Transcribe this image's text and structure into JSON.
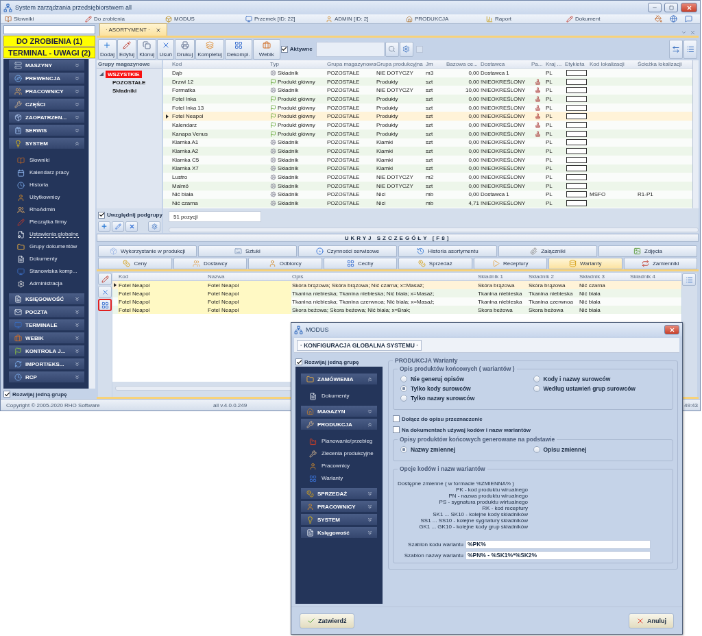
{
  "window": {
    "title": "System zarządzania przedsiębiorstwem all"
  },
  "menu_bar": [
    "Słowniki",
    "Do zrobienia",
    "MODUS",
    "Przemek [ID: 22]",
    "ADMIN [ID: 2]",
    "PRODUKCJA",
    "Raport",
    "Dokument"
  ],
  "banners": [
    "DO ZROBIENIA (1)",
    "TERMINAL - UWAGI (2)"
  ],
  "nav": [
    {
      "label": "MASZYNY",
      "expanded": false
    },
    {
      "label": "PREWENCJA",
      "expanded": false
    },
    {
      "label": "PRACOWNICY",
      "expanded": false
    },
    {
      "label": "CZĘŚCI",
      "expanded": false
    },
    {
      "label": "ZAOPATRZEN...",
      "expanded": false
    },
    {
      "label": "SERWIS",
      "expanded": false
    },
    {
      "label": "SYSTEM",
      "expanded": true,
      "items": [
        {
          "label": "Słowniki",
          "selected": false
        },
        {
          "label": "Kalendarz pracy",
          "selected": false
        },
        {
          "label": "Historia",
          "selected": false
        },
        {
          "label": "Użytkownicy",
          "selected": false
        },
        {
          "label": "RhoAdmin",
          "selected": false
        },
        {
          "label": "Pieczątka firmy",
          "selected": false
        },
        {
          "label": "Ustawienia globalne",
          "selected": true
        },
        {
          "label": "Grupy dokumentów",
          "selected": false
        },
        {
          "label": "Dokumenty",
          "selected": false
        },
        {
          "label": "Stanowiska komp...",
          "selected": false
        },
        {
          "label": "Administracja",
          "selected": false
        }
      ]
    },
    {
      "label": "KSIĘGOWOŚĆ",
      "expanded": false
    },
    {
      "label": "POCZTA",
      "expanded": false
    },
    {
      "label": "TERMINALE",
      "expanded": false
    },
    {
      "label": "WEBIK",
      "expanded": false
    },
    {
      "label": "KONTROLA J...",
      "expanded": false
    },
    {
      "label": "IMPORT/EKS...",
      "expanded": false
    },
    {
      "label": "RCP",
      "expanded": false
    }
  ],
  "expand_one_group": {
    "label": "Rozwijaj jedną grupę",
    "checked": true
  },
  "doc_tabs": [
    {
      "label": "· ASORTYMENT ·",
      "selected": true
    }
  ],
  "toolbar": {
    "buttons": [
      "Dodaj",
      "Edytuj",
      "Klonuj",
      "Usuń",
      "Drukuj",
      "Kompletuj",
      "Dekompl.",
      "Webik"
    ],
    "active_filter": {
      "label": "Aktywne",
      "checked": true
    }
  },
  "groups": {
    "title": "Grupy magazynowe",
    "tree": [
      {
        "label": "WSZYSTKIE",
        "selected": true,
        "expanded": true,
        "children": [
          {
            "label": "POZOSTAŁE",
            "selected": false
          },
          {
            "label": "Składniki",
            "selected": false
          }
        ]
      }
    ],
    "include_subgroups": {
      "label": "Uwzględnij podgrupy",
      "checked": true
    }
  },
  "table": {
    "columns": [
      "Kod",
      "Typ",
      "Grupa magazynowa",
      "Grupa produkcyjna",
      "Jm",
      "Bazowa ce...",
      "Dostawca",
      "Pa...",
      "Kraj ...",
      "Etykieta",
      "Kod lokalizacji",
      "Ścieżka lokalizacji"
    ],
    "rows": [
      {
        "kod": "Dąb",
        "typ": "Składnik",
        "kind": "component",
        "grupa_mag": "POZOSTAŁE",
        "grupa_prod": "NIE DOTYCZY",
        "jm": "m3",
        "cena": "0,00",
        "dostawca": "Dostawca 1",
        "pa_icon": false,
        "kraj": "PL",
        "selected": false
      },
      {
        "kod": "Drzwi 12",
        "typ": "Produkt główny",
        "kind": "product",
        "grupa_mag": "POZOSTAŁE",
        "grupa_prod": "Produkty",
        "jm": "szt",
        "cena": "0,00",
        "dostawca": "!NIEOKREŚLONY",
        "pa_icon": true,
        "kraj": "PL",
        "selected": false
      },
      {
        "kod": "Formatka",
        "typ": "Składnik",
        "kind": "component",
        "grupa_mag": "POZOSTAŁE",
        "grupa_prod": "NIE DOTYCZY",
        "jm": "szt",
        "cena": "10,00",
        "dostawca": "!NIEOKREŚLONY",
        "pa_icon": true,
        "kraj": "PL",
        "selected": false
      },
      {
        "kod": "Fotel Inka",
        "typ": "Produkt główny",
        "kind": "product",
        "grupa_mag": "POZOSTAŁE",
        "grupa_prod": "Produkty",
        "jm": "szt",
        "cena": "0,00",
        "dostawca": "!NIEOKREŚLONY",
        "pa_icon": true,
        "kraj": "PL",
        "selected": false
      },
      {
        "kod": "Fotel Inka 13",
        "typ": "Produkt główny",
        "kind": "product",
        "grupa_mag": "POZOSTAŁE",
        "grupa_prod": "Produkty",
        "jm": "szt",
        "cena": "0,00",
        "dostawca": "!NIEOKREŚLONY",
        "pa_icon": true,
        "kraj": "PL",
        "selected": false
      },
      {
        "kod": "Fotel Neapol",
        "typ": "Produkt główny",
        "kind": "product",
        "grupa_mag": "POZOSTAŁE",
        "grupa_prod": "Produkty",
        "jm": "szt",
        "cena": "0,00",
        "dostawca": "!NIEOKREŚLONY",
        "pa_icon": true,
        "kraj": "PL",
        "selected": true
      },
      {
        "kod": "Kalendarz",
        "typ": "Produkt główny",
        "kind": "product",
        "grupa_mag": "POZOSTAŁE",
        "grupa_prod": "Produkty",
        "jm": "szt",
        "cena": "0,00",
        "dostawca": "!NIEOKREŚLONY",
        "pa_icon": true,
        "kraj": "PL",
        "selected": false
      },
      {
        "kod": "Kanapa Venus",
        "typ": "Produkt główny",
        "kind": "product",
        "grupa_mag": "POZOSTAŁE",
        "grupa_prod": "Produkty",
        "jm": "szt",
        "cena": "0,00",
        "dostawca": "!NIEOKREŚLONY",
        "pa_icon": true,
        "kraj": "PL",
        "selected": false
      },
      {
        "kod": "Klamka A1",
        "typ": "Składnik",
        "kind": "component",
        "grupa_mag": "POZOSTAŁE",
        "grupa_prod": "Klamki",
        "jm": "szt",
        "cena": "0,00",
        "dostawca": "!NIEOKREŚLONY",
        "pa_icon": false,
        "kraj": "PL",
        "selected": false
      },
      {
        "kod": "Klamka A2",
        "typ": "Składnik",
        "kind": "component",
        "grupa_mag": "POZOSTAŁE",
        "grupa_prod": "Klamki",
        "jm": "szt",
        "cena": "0,00",
        "dostawca": "!NIEOKREŚLONY",
        "pa_icon": false,
        "kraj": "PL",
        "selected": false
      },
      {
        "kod": "Klamka C5",
        "typ": "Składnik",
        "kind": "component",
        "grupa_mag": "POZOSTAŁE",
        "grupa_prod": "Klamki",
        "jm": "szt",
        "cena": "0,00",
        "dostawca": "!NIEOKREŚLONY",
        "pa_icon": false,
        "kraj": "PL",
        "selected": false
      },
      {
        "kod": "Klamka X7",
        "typ": "Składnik",
        "kind": "component",
        "grupa_mag": "POZOSTAŁE",
        "grupa_prod": "Klamki",
        "jm": "szt",
        "cena": "0,00",
        "dostawca": "!NIEOKREŚLONY",
        "pa_icon": false,
        "kraj": "PL",
        "selected": false
      },
      {
        "kod": "Lustro",
        "typ": "Składnik",
        "kind": "component",
        "grupa_mag": "POZOSTAŁE",
        "grupa_prod": "NIE DOTYCZY",
        "jm": "m2",
        "cena": "0,00",
        "dostawca": "!NIEOKREŚLONY",
        "pa_icon": false,
        "kraj": "PL",
        "selected": false
      },
      {
        "kod": "Malmö",
        "typ": "Składnik",
        "kind": "component",
        "grupa_mag": "POZOSTAŁE",
        "grupa_prod": "NIE DOTYCZY",
        "jm": "szt",
        "cena": "0,00",
        "dostawca": "!NIEOKREŚLONY",
        "pa_icon": false,
        "kraj": "PL",
        "selected": false
      },
      {
        "kod": "Nić biała",
        "typ": "Składnik",
        "kind": "component",
        "grupa_mag": "POZOSTAŁE",
        "grupa_prod": "Nici",
        "jm": "mb",
        "cena": "0,00",
        "dostawca": "Dostawca 1",
        "pa_icon": false,
        "kraj": "PL",
        "kod_lok": "MSFO",
        "sciezka": "R1-P1",
        "selected": false
      },
      {
        "kod": "Nić czarna",
        "typ": "Składnik",
        "kind": "component",
        "grupa_mag": "POZOSTAŁE",
        "grupa_prod": "Nici",
        "jm": "mb",
        "cena": "4,71",
        "dostawca": "!NIEOKREŚLONY",
        "pa_icon": false,
        "kraj": "PL",
        "selected": false
      }
    ],
    "count": "51 pozycji"
  },
  "details_toggle": "UKRYJ SZCZEGÓŁY [F8]",
  "detail_tabs": [
    [
      {
        "label": "Wykorzystanie w produkcji",
        "selected": false
      },
      {
        "label": "Sztuki",
        "selected": false
      },
      {
        "label": "Czynności serwisowe",
        "selected": false
      },
      {
        "label": "Historia asortymentu",
        "selected": false
      },
      {
        "label": "Załączniki",
        "selected": false
      },
      {
        "label": "Zdjęcia",
        "selected": false
      }
    ],
    [
      {
        "label": "Ceny",
        "selected": false
      },
      {
        "label": "Dostawcy",
        "selected": false
      },
      {
        "label": "Odbiorcy",
        "selected": false
      },
      {
        "label": "Cechy",
        "selected": false
      },
      {
        "label": "Sprzedaż",
        "selected": false
      },
      {
        "label": "Receptury",
        "selected": false
      },
      {
        "label": "Warianty",
        "selected": true
      },
      {
        "label": "Zamienniki",
        "selected": false
      }
    ]
  ],
  "variants": {
    "tools": [
      {
        "highlighted": false
      },
      {
        "highlighted": false
      },
      {
        "highlighted": true
      }
    ],
    "columns": [
      "Kod",
      "Nazwa",
      "Opis",
      "Składnik 1",
      "Składnik 2",
      "Składnik 3",
      "Składnik 4"
    ],
    "rows": [
      {
        "kod": "Fotel Neapol",
        "nazwa": "Fotel Neapol",
        "opis": "Skóra brązowa; Skóra brązowa; Nić czarna; x=Masaż;",
        "s1": "Skóra brązowa",
        "s2": "Skóra brązowa",
        "s3": "Nić czarna",
        "selected": true
      },
      {
        "kod": "Fotel Neapol",
        "nazwa": "Fotel Neapol",
        "opis": "Tkanina niebieska; Tkanina niebieska; Nić biała; x=Masaż;",
        "s1": "Tkanina niebieska",
        "s2": "Tkanina niebieska",
        "s3": "Nić biała",
        "selected": false
      },
      {
        "kod": "Fotel Neapol",
        "nazwa": "Fotel Neapol",
        "opis": "Tkanina niebieska; Tkanina czerwnoa; Nić biała; x=Masaż;",
        "s1": "Tkanina niebieska",
        "s2": "Tkanina czerwnoa",
        "s3": "Nić biała",
        "selected": false
      },
      {
        "kod": "Fotel Neapol",
        "nazwa": "Fotel Neapol",
        "opis": "Skora beżowa; Skora beżowa; Nić biała; x=Brak;",
        "s1": "Skora beżowa",
        "s2": "Skora beżowa",
        "s3": "Nić biała",
        "selected": false
      }
    ]
  },
  "status_bar": {
    "copyright": "Copyright © 2005-2020 RHO Software",
    "version": "all v.4.0.0.249",
    "time": "49:43"
  },
  "dialog": {
    "title": "MODUS",
    "tab": "· KONFIGURACJA GLOBALNA SYSTEMU ·",
    "expand_one_group": {
      "label": "Rozwijaj jedną grupę",
      "checked": true
    },
    "nav": [
      {
        "label": "ZAMÓWIENIA",
        "expanded": true,
        "items": [
          {
            "label": "Dokumenty"
          }
        ]
      },
      {
        "label": "MAGAZYN",
        "expanded": false
      },
      {
        "label": "PRODUKCJA",
        "expanded": true,
        "items": [
          {
            "label": "Planowanie/przebieg"
          },
          {
            "label": "Zlecenia produkcyjne"
          },
          {
            "label": "Pracownicy"
          },
          {
            "label": "Warianty"
          }
        ]
      },
      {
        "label": "SPRZEDAŻ",
        "expanded": false
      },
      {
        "label": "PRACOWNICY",
        "expanded": false
      },
      {
        "label": "SYSTEM",
        "expanded": false
      },
      {
        "label": "Księgowość",
        "expanded": false
      }
    ],
    "section": {
      "title": "PRODUKCJA Warianty",
      "description": {
        "title": "Opis produktów końcowych ( wariantów )",
        "options": [
          {
            "label": "Nie generuj opisów",
            "selected": false
          },
          {
            "label": "Kody i nazwy surowców",
            "selected": false
          },
          {
            "label": "Tylko kody surowców",
            "selected": true
          },
          {
            "label": "Według ustawień grup surowców",
            "selected": false
          },
          {
            "label": "Tylko nazwy surowców",
            "selected": false
          }
        ]
      },
      "checkboxes": [
        {
          "label": "Dołącz do opisu przeznaczenie",
          "checked": false
        },
        {
          "label": "Na dokumentach używaj kodów i nazw wariantów",
          "checked": false
        }
      ],
      "source": {
        "title": "Opisy produktów końcowych generowane na podstawie",
        "options": [
          {
            "label": "Nazwy zmiennej",
            "selected": true
          },
          {
            "label": "Opisu zmiennej",
            "selected": false
          }
        ]
      },
      "codes": {
        "title": "Opcje kodów i nazw wariantów",
        "help_title": "Dostępne zmienne ( w formacie %ZMIENNA% )",
        "help": [
          "PK - kod produktu wirualnego",
          "PN - nazwa produktu wirualnego",
          "PS - sygnatura produktu wirtualnego",
          "RK - kod receptury",
          "SK1 ... SK10 - kolejne kody składników",
          "SS1 ... SS10 - kolejne sygnatury składników",
          "GK1 ... GK10 - kolejne kody grup składników"
        ],
        "fields": [
          {
            "label": "Szablon kodu wariantu",
            "value": "%PK%"
          },
          {
            "label": "Szablon nazwy wariantu",
            "value": "%PN% - %SK1%*%SK2%"
          }
        ]
      }
    },
    "buttons": [
      "Zatwierdź",
      "Anuluj"
    ]
  }
}
